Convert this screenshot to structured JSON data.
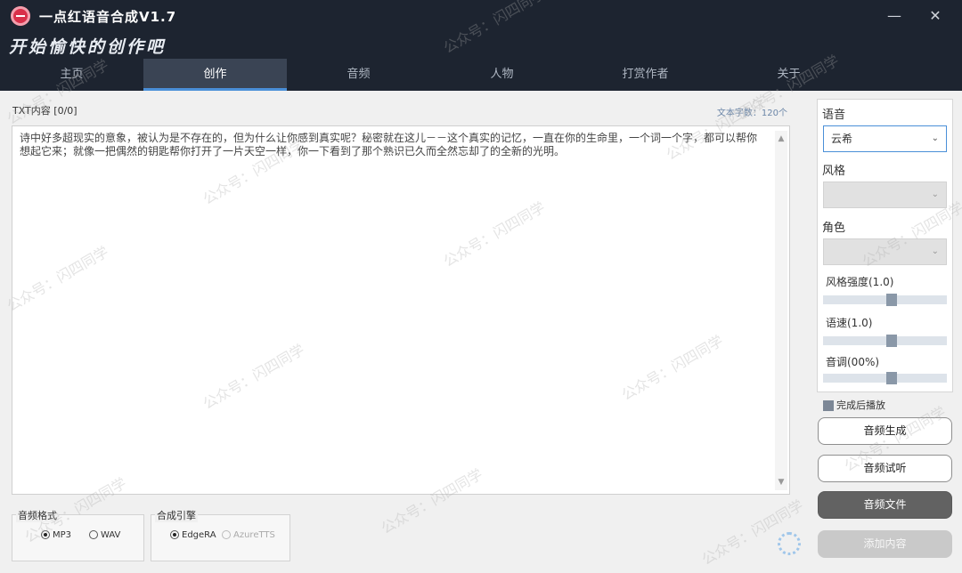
{
  "window": {
    "title": "一点红语音合成V1.7",
    "minimize_glyph": "—",
    "close_glyph": "✕"
  },
  "banner": {
    "slogan": "开始愉快的创作吧"
  },
  "tabs": [
    {
      "label": "主页"
    },
    {
      "label": "创作"
    },
    {
      "label": "音频"
    },
    {
      "label": "人物"
    },
    {
      "label": "打赏作者"
    },
    {
      "label": "关于"
    }
  ],
  "editor": {
    "label": "TXT内容  [0/0]",
    "word_count": "文本字数：120个",
    "content": "诗中好多超现实的意象，被认为是不存在的，但为什么让你感到真实呢？秘密就在这儿－－这个真实的记忆，一直在你的生命里，一个词一个字，都可以帮你想起它来；就像一把偶然的钥匙帮你打开了一片天空一样，你一下看到了那个熟识已久而全然忘却了的全新的光明。",
    "scroll_up": "▲",
    "scroll_down": "▼"
  },
  "audio_format": {
    "title": "音频格式",
    "options": [
      {
        "label": "MP3",
        "selected": true
      },
      {
        "label": "WAV",
        "selected": false
      }
    ]
  },
  "engine": {
    "title": "合成引擎",
    "options": [
      {
        "label": "EdgeRA",
        "selected": true
      },
      {
        "label": "AzureTTS",
        "selected": false
      }
    ]
  },
  "settings": {
    "voice_label": "语音",
    "voice_value": "云希",
    "style_label": "风格",
    "style_value": "",
    "role_label": "角色",
    "role_value": "",
    "style_strength_label": "风格强度(1.0)",
    "style_strength_level": 0.5,
    "speed_label": "语速(1.0)",
    "speed_level": 0.5,
    "pitch_label": "音调(00%)",
    "pitch_level": 0.5,
    "chevron": "⌄"
  },
  "play_after": {
    "label": "完成后播放",
    "checked": true
  },
  "buttons": {
    "generate": "音频生成",
    "preview": "音频试听",
    "file": "音频文件",
    "add": "添加内容"
  },
  "colors": {
    "titlebar": "#1d2430",
    "active_tab": "#3a4454",
    "accent": "#4a8fd8",
    "logo": "#d9304a"
  },
  "watermark": "公众号：闪四同学"
}
